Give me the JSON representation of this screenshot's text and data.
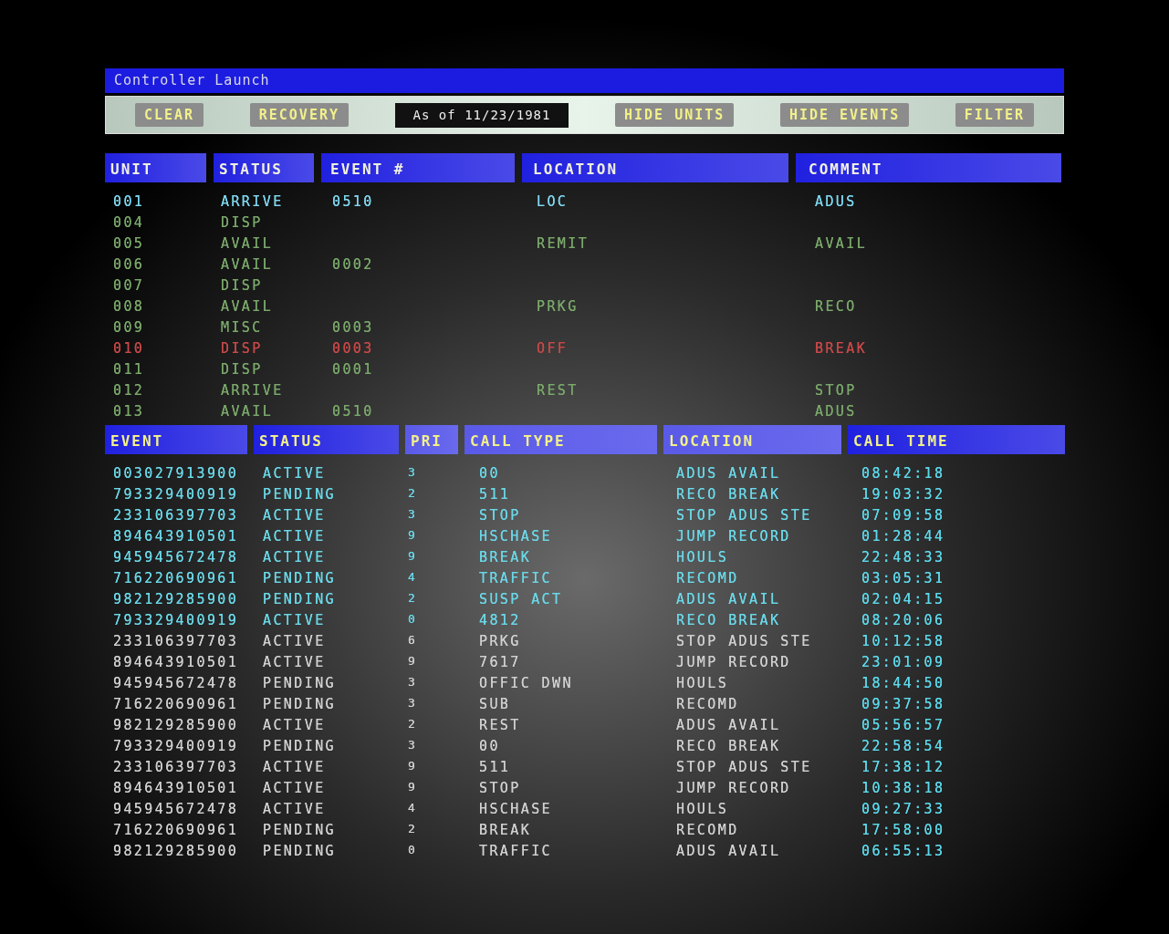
{
  "window": {
    "title": "Controller Launch"
  },
  "toolbar": {
    "buttons_left": [
      "CLEAR",
      "RECOVERY"
    ],
    "date": "As of 11/23/1981",
    "buttons_right": [
      "HIDE UNITS",
      "HIDE EVENTS",
      "FILTER"
    ]
  },
  "units": {
    "columns": [
      "UNIT",
      "STATUS",
      "EVENT #",
      "LOCATION",
      "COMMENT"
    ],
    "rows": [
      {
        "unit": "001",
        "status": "ARRIVE",
        "event": "0510",
        "location": "LOC",
        "comment": "ADUS",
        "color": "#7fd8f0"
      },
      {
        "unit": "004",
        "status": "DISP",
        "color": "#7aa86a"
      },
      {
        "unit": "005",
        "status": "AVAIL",
        "location": "REMIT",
        "comment": "AVAIL",
        "color": "#7aa86a"
      },
      {
        "unit": "006",
        "status": "AVAIL",
        "event": "0002",
        "color": "#7aa86a"
      },
      {
        "unit": "007",
        "status": "DISP",
        "color": "#7aa86a"
      },
      {
        "unit": "008",
        "status": "AVAIL",
        "location": "PRKG",
        "comment": "RECO",
        "color": "#7aa86a"
      },
      {
        "unit": "009",
        "status": "MISC",
        "event": "0003",
        "color": "#7aa86a"
      },
      {
        "unit": "010",
        "status": "DISP",
        "event": "0003",
        "location": "OFF",
        "comment": "BREAK",
        "color": "#c84848"
      },
      {
        "unit": "011",
        "status": "DISP",
        "event": "0001",
        "color": "#7aa86a"
      },
      {
        "unit": "012",
        "status": "ARRIVE",
        "location": "REST",
        "comment": "STOP",
        "color": "#7aa86a"
      },
      {
        "unit": "013",
        "status": "AVAIL",
        "event": "0510",
        "comment": "ADUS",
        "color": "#7aa86a"
      }
    ]
  },
  "events": {
    "columns": [
      "EVENT",
      "STATUS",
      "PRI",
      "CALL TYPE",
      "LOCATION",
      "CALL TIME"
    ],
    "rows": [
      {
        "event": "003027913900",
        "status": "ACTIVE",
        "pri": "3",
        "call_type": "00",
        "location": "ADUS AVAIL",
        "call_time": "08:42:18",
        "color": "#6ad8e8"
      },
      {
        "event": "793329400919",
        "status": "PENDING",
        "pri": "2",
        "call_type": "511",
        "location": "RECO BREAK",
        "call_time": "19:03:32",
        "color": "#6ad8e8"
      },
      {
        "event": "233106397703",
        "status": "ACTIVE",
        "pri": "3",
        "call_type": "STOP",
        "location": "STOP ADUS STE",
        "call_time": "07:09:58",
        "color": "#6ad8e8"
      },
      {
        "event": "894643910501",
        "status": "ACTIVE",
        "pri": "9",
        "call_type": "HSCHASE",
        "location": "JUMP RECORD",
        "call_time": "01:28:44",
        "color": "#6ad8e8"
      },
      {
        "event": "945945672478",
        "status": "ACTIVE",
        "pri": "9",
        "call_type": "BREAK",
        "location": "HOULS",
        "call_time": "22:48:33",
        "color": "#6ad8e8"
      },
      {
        "event": "716220690961",
        "status": "PENDING",
        "pri": "4",
        "call_type": "TRAFFIC",
        "location": "RECOMD",
        "call_time": "03:05:31",
        "color": "#6ad8e8"
      },
      {
        "event": "982129285900",
        "status": "PENDING",
        "pri": "2",
        "call_type": "SUSP ACT",
        "location": "ADUS AVAIL",
        "call_time": "02:04:15",
        "color": "#6ad8e8"
      },
      {
        "event": "793329400919",
        "status": "ACTIVE",
        "pri": "0",
        "call_type": "4812",
        "location": "RECO BREAK",
        "call_time": "08:20:06",
        "color": "#6ad8e8"
      },
      {
        "event": "233106397703",
        "status": "ACTIVE",
        "pri": "6",
        "call_type": "PRKG",
        "location": "STOP ADUS STE",
        "call_time": "10:12:58",
        "color": "#d0d0d0"
      },
      {
        "event": "894643910501",
        "status": "ACTIVE",
        "pri": "9",
        "call_type": "7617",
        "location": "JUMP RECORD",
        "call_time": "23:01:09",
        "color": "#d0d0d0"
      },
      {
        "event": "945945672478",
        "status": "PENDING",
        "pri": "3",
        "call_type": "OFFIC DWN",
        "location": "HOULS",
        "call_time": "18:44:50",
        "color": "#d0d0d0"
      },
      {
        "event": "716220690961",
        "status": "PENDING",
        "pri": "3",
        "call_type": "SUB",
        "location": "RECOMD",
        "call_time": "09:37:58",
        "color": "#d0d0d0"
      },
      {
        "event": "982129285900",
        "status": "ACTIVE",
        "pri": "2",
        "call_type": "REST",
        "location": "ADUS AVAIL",
        "call_time": "05:56:57",
        "color": "#d0d0d0"
      },
      {
        "event": "793329400919",
        "status": "PENDING",
        "pri": "3",
        "call_type": "00",
        "location": "RECO BREAK",
        "call_time": "22:58:54",
        "color": "#d0d0d0"
      },
      {
        "event": "233106397703",
        "status": "ACTIVE",
        "pri": "9",
        "call_type": "511",
        "location": "STOP ADUS STE",
        "call_time": "17:38:12",
        "color": "#d0d0d0"
      },
      {
        "event": "894643910501",
        "status": "ACTIVE",
        "pri": "9",
        "call_type": "STOP",
        "location": "JUMP RECORD",
        "call_time": "10:38:18",
        "color": "#d0d0d0"
      },
      {
        "event": "945945672478",
        "status": "ACTIVE",
        "pri": "4",
        "call_type": "HSCHASE",
        "location": "HOULS",
        "call_time": "09:27:33",
        "color": "#d0d0d0"
      },
      {
        "event": "716220690961",
        "status": "PENDING",
        "pri": "2",
        "call_type": "BREAK",
        "location": "RECOMD",
        "call_time": "17:58:00",
        "color": "#d0d0d0"
      },
      {
        "event": "982129285900",
        "status": "PENDING",
        "pri": "0",
        "call_type": "TRAFFIC",
        "location": "ADUS AVAIL",
        "call_time": "06:55:13",
        "color": "#d0d0d0"
      }
    ]
  }
}
